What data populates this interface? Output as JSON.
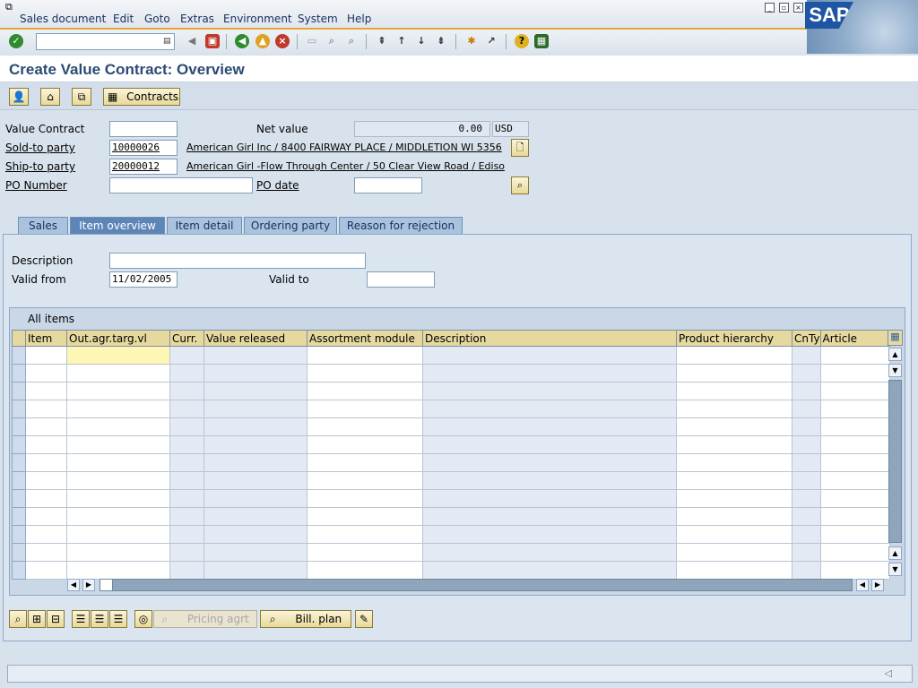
{
  "menu": [
    "Sales document",
    "Edit",
    "Goto",
    "Extras",
    "Environment",
    "System",
    "Help"
  ],
  "brand": "SAP",
  "title": "Create Value Contract: Overview",
  "app_toolbar": {
    "contracts_label": "Contracts"
  },
  "header": {
    "value_contract_label": "Value Contract",
    "value_contract_value": "",
    "net_value_label": "Net value",
    "net_value": "0.00",
    "currency": "USD",
    "sold_to_label": "Sold-to party",
    "sold_to_value": "10000026",
    "sold_to_desc": "American Girl Inc / 8400 FAIRWAY PLACE / MIDDLETION WI 5356",
    "ship_to_label": "Ship-to party",
    "ship_to_value": "20000012",
    "ship_to_desc": "American Girl -Flow Through Center / 50 Clear View Road / Ediso",
    "po_number_label": "PO Number",
    "po_number_value": "",
    "po_date_label": "PO date",
    "po_date_value": ""
  },
  "tabs": [
    "Sales",
    "Item overview",
    "Item detail",
    "Ordering party",
    "Reason for rejection"
  ],
  "active_tab": "Item overview",
  "overview": {
    "description_label": "Description",
    "description_value": "",
    "valid_from_label": "Valid from",
    "valid_from_value": "11/02/2005",
    "valid_to_label": "Valid to",
    "valid_to_value": ""
  },
  "table": {
    "caption": "All items",
    "columns": [
      "Item",
      "Out.agr.targ.vl",
      "Curr.",
      "Value released",
      "Assortment module",
      "Description",
      "Product hierarchy",
      "CnTy",
      "Article"
    ],
    "row_count": 13
  },
  "bottom_buttons": {
    "pricing_label": "Pricing agrt",
    "billplan_label": "Bill. plan"
  },
  "colors": {
    "accent": "#e8a33a",
    "title": "#2c4a75",
    "tab_active": "#5d86b7"
  }
}
